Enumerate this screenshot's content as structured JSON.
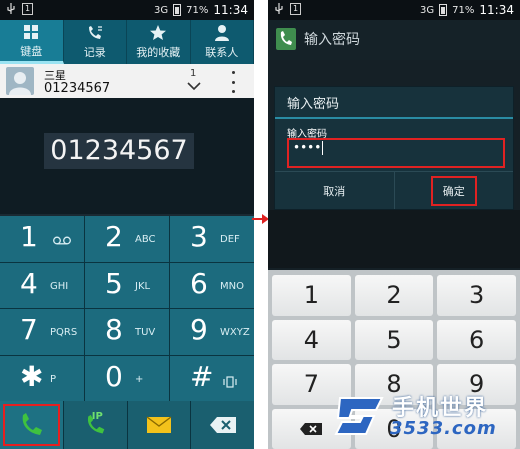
{
  "left_screen": {
    "status_bar": {
      "network": "3G",
      "battery": "71%",
      "time": "11:34"
    },
    "tabs": [
      {
        "label": "键盘",
        "icon": "keypad-icon",
        "active": true
      },
      {
        "label": "记录",
        "icon": "call-log-icon",
        "active": false
      },
      {
        "label": "我的收藏",
        "icon": "star-icon",
        "active": false
      },
      {
        "label": "联系人",
        "icon": "person-icon",
        "active": false
      }
    ],
    "contact": {
      "name": "三星",
      "number": "01234567",
      "count": "1"
    },
    "dialed_number": "01234567",
    "keys": [
      {
        "digit": "1",
        "letters": "",
        "icon": "voicemail-icon"
      },
      {
        "digit": "2",
        "letters": "ABC"
      },
      {
        "digit": "3",
        "letters": "DEF"
      },
      {
        "digit": "4",
        "letters": "GHI"
      },
      {
        "digit": "5",
        "letters": "JKL"
      },
      {
        "digit": "6",
        "letters": "MNO"
      },
      {
        "digit": "7",
        "letters": "PQRS"
      },
      {
        "digit": "8",
        "letters": "TUV"
      },
      {
        "digit": "9",
        "letters": "WXYZ"
      },
      {
        "digit": "✱",
        "letters": "P"
      },
      {
        "digit": "0",
        "letters": "+"
      },
      {
        "digit": "#",
        "letters": ""
      }
    ],
    "call_row": {
      "ip_label": "IP"
    }
  },
  "right_screen": {
    "status_bar": {
      "network": "3G",
      "battery": "71%",
      "time": "11:34"
    },
    "app_title": "输入密码",
    "dialog": {
      "title": "输入密码",
      "field_label": "输入密码",
      "field_value": "••••",
      "cancel_label": "取消",
      "confirm_label": "确定"
    },
    "numpad": [
      "1",
      "2",
      "3",
      "4",
      "5",
      "6",
      "7",
      "8",
      "9",
      "",
      "0",
      ""
    ]
  },
  "watermark": {
    "title": "手机世界",
    "site": "3533.com"
  },
  "colors": {
    "highlight": "#e02222",
    "tab_active": "#187d96",
    "key_bg": "#1c6b7e"
  }
}
